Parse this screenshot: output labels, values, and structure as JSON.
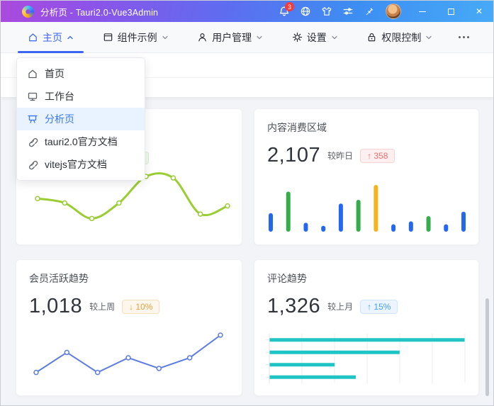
{
  "titlebar": {
    "title": "分析页 - Tauri2.0-Vue3Admin",
    "notification_count": "3"
  },
  "navbar": {
    "items": [
      {
        "label": "主页",
        "active": true
      },
      {
        "label": "组件示例",
        "active": false
      },
      {
        "label": "用户管理",
        "active": false
      },
      {
        "label": "设置",
        "active": false
      },
      {
        "label": "权限控制",
        "active": false
      }
    ]
  },
  "dropdown": {
    "items": [
      {
        "label": "首页",
        "active": false
      },
      {
        "label": "工作台",
        "active": false
      },
      {
        "label": "分析页",
        "active": true
      },
      {
        "label": "tauri2.0官方文档",
        "active": false
      },
      {
        "label": "vitejs官方文档",
        "active": false
      }
    ]
  },
  "cards": {
    "content": {
      "title": "内容消费区域",
      "value": "2,107",
      "compare_label": "较昨日",
      "badge": "↑ 358"
    },
    "member": {
      "title": "会员活跃趋势",
      "value": "1,018",
      "compare_label": "较上周",
      "badge": "↓ 10%"
    },
    "comment": {
      "title": "评论趋势",
      "value": "1,326",
      "compare_label": "较上月",
      "badge": "↑ 15%"
    }
  },
  "colors": {
    "accent_blue": "#3a66f2",
    "titlebar_gradient_left": "#ab4ade",
    "titlebar_gradient_right": "#47aaf7",
    "badge_danger_text": "#f56c6c",
    "badge_warning_text": "#e6a23c",
    "badge_primary_text": "#409eff",
    "dropdown_active_bg": "#e9f2ff"
  },
  "chart_data": [
    {
      "id": "visit-trend-line",
      "type": "line",
      "smooth": true,
      "color": "#9acd32",
      "stroke": 3,
      "values": [
        43,
        37,
        16,
        37,
        73,
        71,
        22,
        33
      ],
      "title": "",
      "xlabel": "",
      "ylabel": "",
      "axes_visible": false
    },
    {
      "id": "content-consumption-bars",
      "type": "bar",
      "values": [
        25,
        54,
        12,
        8,
        38,
        43,
        63,
        10,
        14,
        21,
        10,
        27
      ],
      "colors": [
        "#2468f2",
        "#34ad4a",
        "#2468f2",
        "#2468f2",
        "#2468f2",
        "#34ad4a",
        "#f7b31e",
        "#2468f2",
        "#2468f2",
        "#34ad4a",
        "#2468f2",
        "#2468f2"
      ],
      "title": "",
      "axes_visible": false
    },
    {
      "id": "member-activity-line",
      "type": "line",
      "smooth": false,
      "color": "#5b7ce0",
      "stroke": 2,
      "values": [
        10,
        40,
        10,
        32,
        16,
        32,
        66
      ],
      "title": "",
      "axes_visible": false
    },
    {
      "id": "comment-trend-hbars",
      "type": "hbar",
      "values": [
        600,
        400,
        200,
        265
      ],
      "xmax": 600,
      "gridlines": 7,
      "color": "#20c4c4",
      "title": "",
      "grid": true
    }
  ]
}
